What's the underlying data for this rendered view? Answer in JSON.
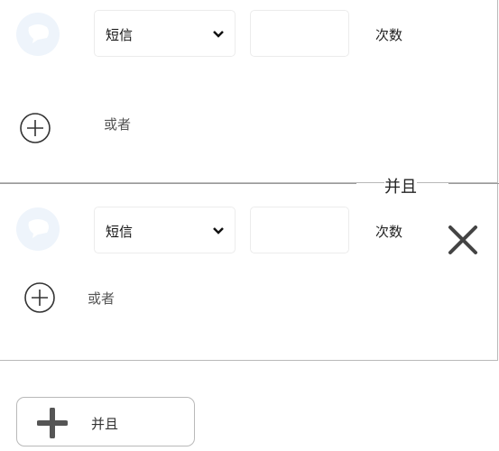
{
  "condition_groups": [
    {
      "rows": [
        {
          "channel": "短信",
          "count_value": "",
          "unit": "次数"
        }
      ],
      "add_or_label": "或者"
    },
    {
      "rows": [
        {
          "channel": "短信",
          "count_value": "",
          "unit": "次数"
        }
      ],
      "add_or_label": "或者"
    }
  ],
  "and_separator_label": "并且",
  "add_and_button_label": "并且",
  "icons": {
    "channel": "chat-bubble-icon",
    "dropdown": "chevron-down-icon",
    "add_or": "plus-circle-icon",
    "remove": "close-icon",
    "add_and": "plus-icon"
  },
  "colors": {
    "icon_background": "#eef4fb",
    "border": "#b9b9b9",
    "icon_stroke": "#333333"
  }
}
